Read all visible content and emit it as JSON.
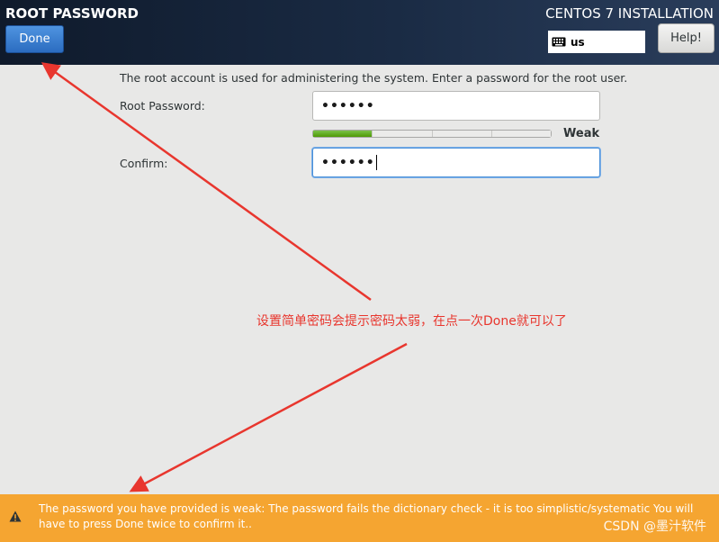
{
  "header": {
    "screen_title": "ROOT PASSWORD",
    "product_title": "CENTOS 7 INSTALLATION",
    "done_label": "Done",
    "keyboard_layout": "us",
    "help_label": "Help!"
  },
  "form": {
    "intro_text": "The root account is used for administering the system.  Enter a password for the root user.",
    "root_password_label": "Root Password:",
    "root_password_value": "••••••",
    "strength_label": "Weak",
    "strength_level": 0.25,
    "confirm_label": "Confirm:",
    "confirm_value": "••••••"
  },
  "annotation": {
    "text": "设置简单密码会提示密码太弱，在点一次Done就可以了",
    "color": "#e8362e"
  },
  "warning": {
    "text": "The password you have provided is weak: The password fails the dictionary check - it is too simplistic/systematic You will have to press Done twice to confirm it..",
    "bar_color": "#f5a531"
  },
  "watermark": {
    "text": "CSDN @墨汁软件"
  },
  "icons": {
    "keyboard": "keyboard-icon",
    "warning": "warning-icon"
  }
}
